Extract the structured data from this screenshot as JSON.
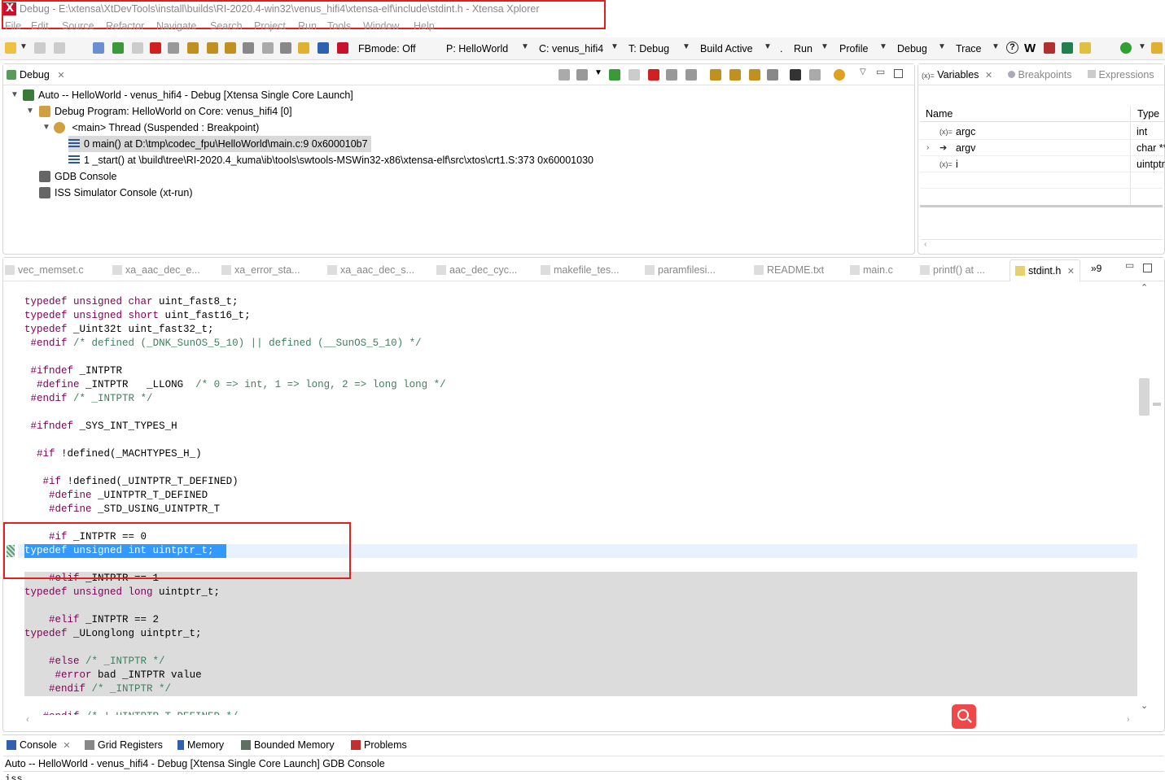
{
  "window": {
    "title": "Debug - E:\\xtensa\\XtDevTools\\install\\builds\\RI-2020.4-win32\\venus_hifi4\\xtensa-elf\\include\\stdint.h - Xtensa Xplorer",
    "logo_letter": "X"
  },
  "menu": [
    "File",
    "Edit",
    "Source",
    "Refactor",
    "Navigate",
    "Search",
    "Project",
    "Run",
    "Tools",
    "Window",
    "Help"
  ],
  "toolbar": {
    "fbmode": "FBmode: Off",
    "project": "P: HelloWorld",
    "core": "C: venus_hifi4",
    "target": "T: Debug",
    "build": "Build Active",
    "dot": ".",
    "run": "Run",
    "profile": "Profile",
    "debug": "Debug",
    "trace": "Trace",
    "help_glyph": "?",
    "w_glyph": "W"
  },
  "debug_view": {
    "tab_label": "Debug",
    "tree": [
      {
        "label": "Auto -- HelloWorld - venus_hifi4 - Debug [Xtensa Single Core Launch]"
      },
      {
        "label": "Debug Program: HelloWorld on Core: venus_hifi4 [0]"
      },
      {
        "label": "<main> Thread (Suspended : Breakpoint)"
      },
      {
        "label": "0 main() at D:\\tmp\\codec_fpu\\HelloWorld\\main.c:9 0x600010b7"
      },
      {
        "label": "1 _start() at \\build\\tree\\RI-2020.4_kuma\\ib\\tools\\swtools-MSWin32-x86\\xtensa-elf\\src\\xtos\\crt1.S:373 0x60001030"
      },
      {
        "label": "GDB Console"
      },
      {
        "label": "ISS  Simulator Console (xt-run)"
      }
    ]
  },
  "variables_view": {
    "tabs": [
      "Variables",
      "Breakpoints",
      "Expressions"
    ],
    "tab_prefix": "(x)=",
    "columns": [
      "Name",
      "Type"
    ],
    "rows": [
      {
        "name": "argc",
        "type": "int",
        "prefix": "(x)="
      },
      {
        "name": "argv",
        "type": "char **",
        "prefix": "➔"
      },
      {
        "name": "i",
        "type": "uintptr",
        "prefix": "(x)="
      }
    ]
  },
  "editor": {
    "tabs": [
      "vec_memset.c",
      "xa_aac_dec_e...",
      "xa_error_sta...",
      "xa_aac_dec_s...",
      "aac_dec_cyc...",
      "makefile_tes...",
      "paramfilesi...",
      "README.txt",
      "main.c",
      "printf() at ...",
      "stdint.h"
    ],
    "overflow": "»9",
    "lines": [
      {
        "t": "typedef unsigned char uint_fast8_t;"
      },
      {
        "t": "typedef unsigned short uint_fast16_t;"
      },
      {
        "t": "typedef _Uint32t uint_fast32_t;"
      },
      {
        "t": " #endif /* defined (_DNK_SunOS_5_10) || defined (__SunOS_5_10) */"
      },
      {
        "t": ""
      },
      {
        "t": " #ifndef _INTPTR"
      },
      {
        "t": "  #define _INTPTR   _LLONG  /* 0 => int, 1 => long, 2 => long long */"
      },
      {
        "t": " #endif /* _INTPTR */"
      },
      {
        "t": ""
      },
      {
        "t": " #ifndef _SYS_INT_TYPES_H"
      },
      {
        "t": ""
      },
      {
        "t": "  #if !defined(_MACHTYPES_H_)"
      },
      {
        "t": ""
      },
      {
        "t": "   #if !defined(_UINTPTR_T_DEFINED)"
      },
      {
        "t": "    #define _UINTPTR_T_DEFINED"
      },
      {
        "t": "    #define _STD_USING_UINTPTR_T"
      },
      {
        "t": ""
      },
      {
        "t": "    #if _INTPTR == 0"
      },
      {
        "t": "typedef unsigned int uintptr_t;"
      },
      {
        "t": ""
      },
      {
        "t": "    #elif _INTPTR == 1"
      },
      {
        "t": "typedef unsigned long uintptr_t;"
      },
      {
        "t": ""
      },
      {
        "t": "    #elif _INTPTR == 2"
      },
      {
        "t": "typedef _ULonglong uintptr_t;"
      },
      {
        "t": ""
      },
      {
        "t": "    #else /* _INTPTR */"
      },
      {
        "t": "     #error bad _INTPTR value"
      },
      {
        "t": "    #endif /* _INTPTR */"
      },
      {
        "t": ""
      },
      {
        "t": "   #endif /* !_UINTPTR_T_DEFINED */"
      }
    ]
  },
  "bottom": {
    "tabs": [
      "Console",
      "Grid Registers",
      "Memory",
      "Bounded Memory",
      "Problems"
    ],
    "console_line": "Auto -- HelloWorld - venus_hifi4 - Debug [Xtensa Single Core Launch] GDB Console",
    "console_next": "iss"
  },
  "colors": {
    "highlight_box": "#e0201e",
    "selection": "#3399ff",
    "inactive_block": "#dcdcdc",
    "current_line": "#e8f2fe",
    "keyword": "#7f0055",
    "comment": "#3f7f5f"
  }
}
